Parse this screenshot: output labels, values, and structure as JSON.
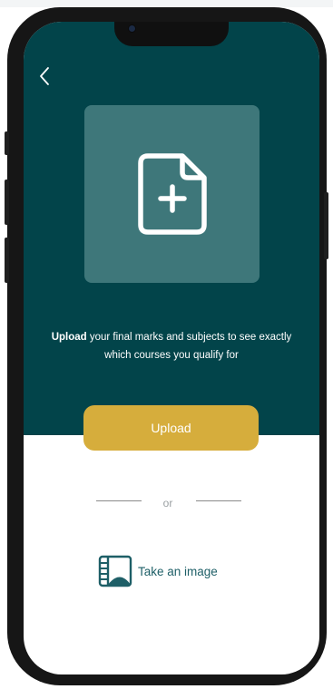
{
  "description": {
    "bold": "Upload",
    "line1_rest": " your final marks and subjects to see exactly",
    "line2": "which courses you qualify for"
  },
  "upload_button": {
    "label": "Upload"
  },
  "separator": {
    "text": "or"
  },
  "take_image": {
    "label": "Take an image"
  },
  "icons": {
    "back": "chevron-left-icon",
    "file_add": "file-plus-icon",
    "image": "image-frame-icon"
  },
  "colors": {
    "header_background": "#02444a",
    "tile_background": "#3e777a",
    "accent_button": "#d6ad3c",
    "link_text": "#1e5f67"
  }
}
